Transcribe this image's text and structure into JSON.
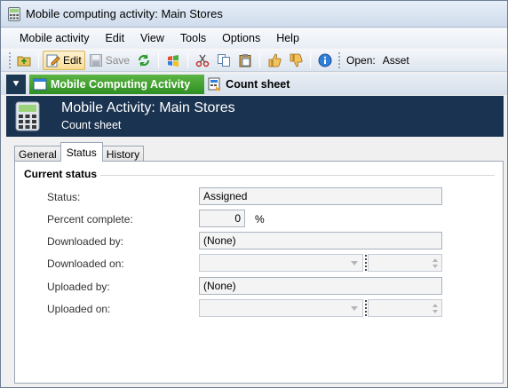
{
  "window": {
    "title": "Mobile computing activity: Main Stores"
  },
  "menu": [
    "Mobile activity",
    "Edit",
    "View",
    "Tools",
    "Options",
    "Help"
  ],
  "toolbar": {
    "edit_label": "Edit",
    "save_label": "Save",
    "open_label": "Open:",
    "open_value": "Asset"
  },
  "nav": {
    "tabs": [
      {
        "label": "Mobile Computing Activity"
      },
      {
        "label": "Count sheet"
      }
    ]
  },
  "header": {
    "title": "Mobile Activity: Main Stores",
    "subtitle": "Count sheet"
  },
  "tabs": [
    "General",
    "Status",
    "History"
  ],
  "status_group": {
    "title": "Current status",
    "fields": {
      "status": {
        "label": "Status:",
        "value": "Assigned"
      },
      "percent": {
        "label": "Percent complete:",
        "value": "0",
        "unit": "%"
      },
      "downloaded_by": {
        "label": "Downloaded by:",
        "value": "(None)"
      },
      "downloaded_on": {
        "label": "Downloaded on:"
      },
      "uploaded_by": {
        "label": "Uploaded by:",
        "value": "(None)"
      },
      "uploaded_on": {
        "label": "Uploaded on:"
      }
    }
  },
  "colors": {
    "header_bg": "#1a3350",
    "active_nav": "#2f8f22"
  }
}
